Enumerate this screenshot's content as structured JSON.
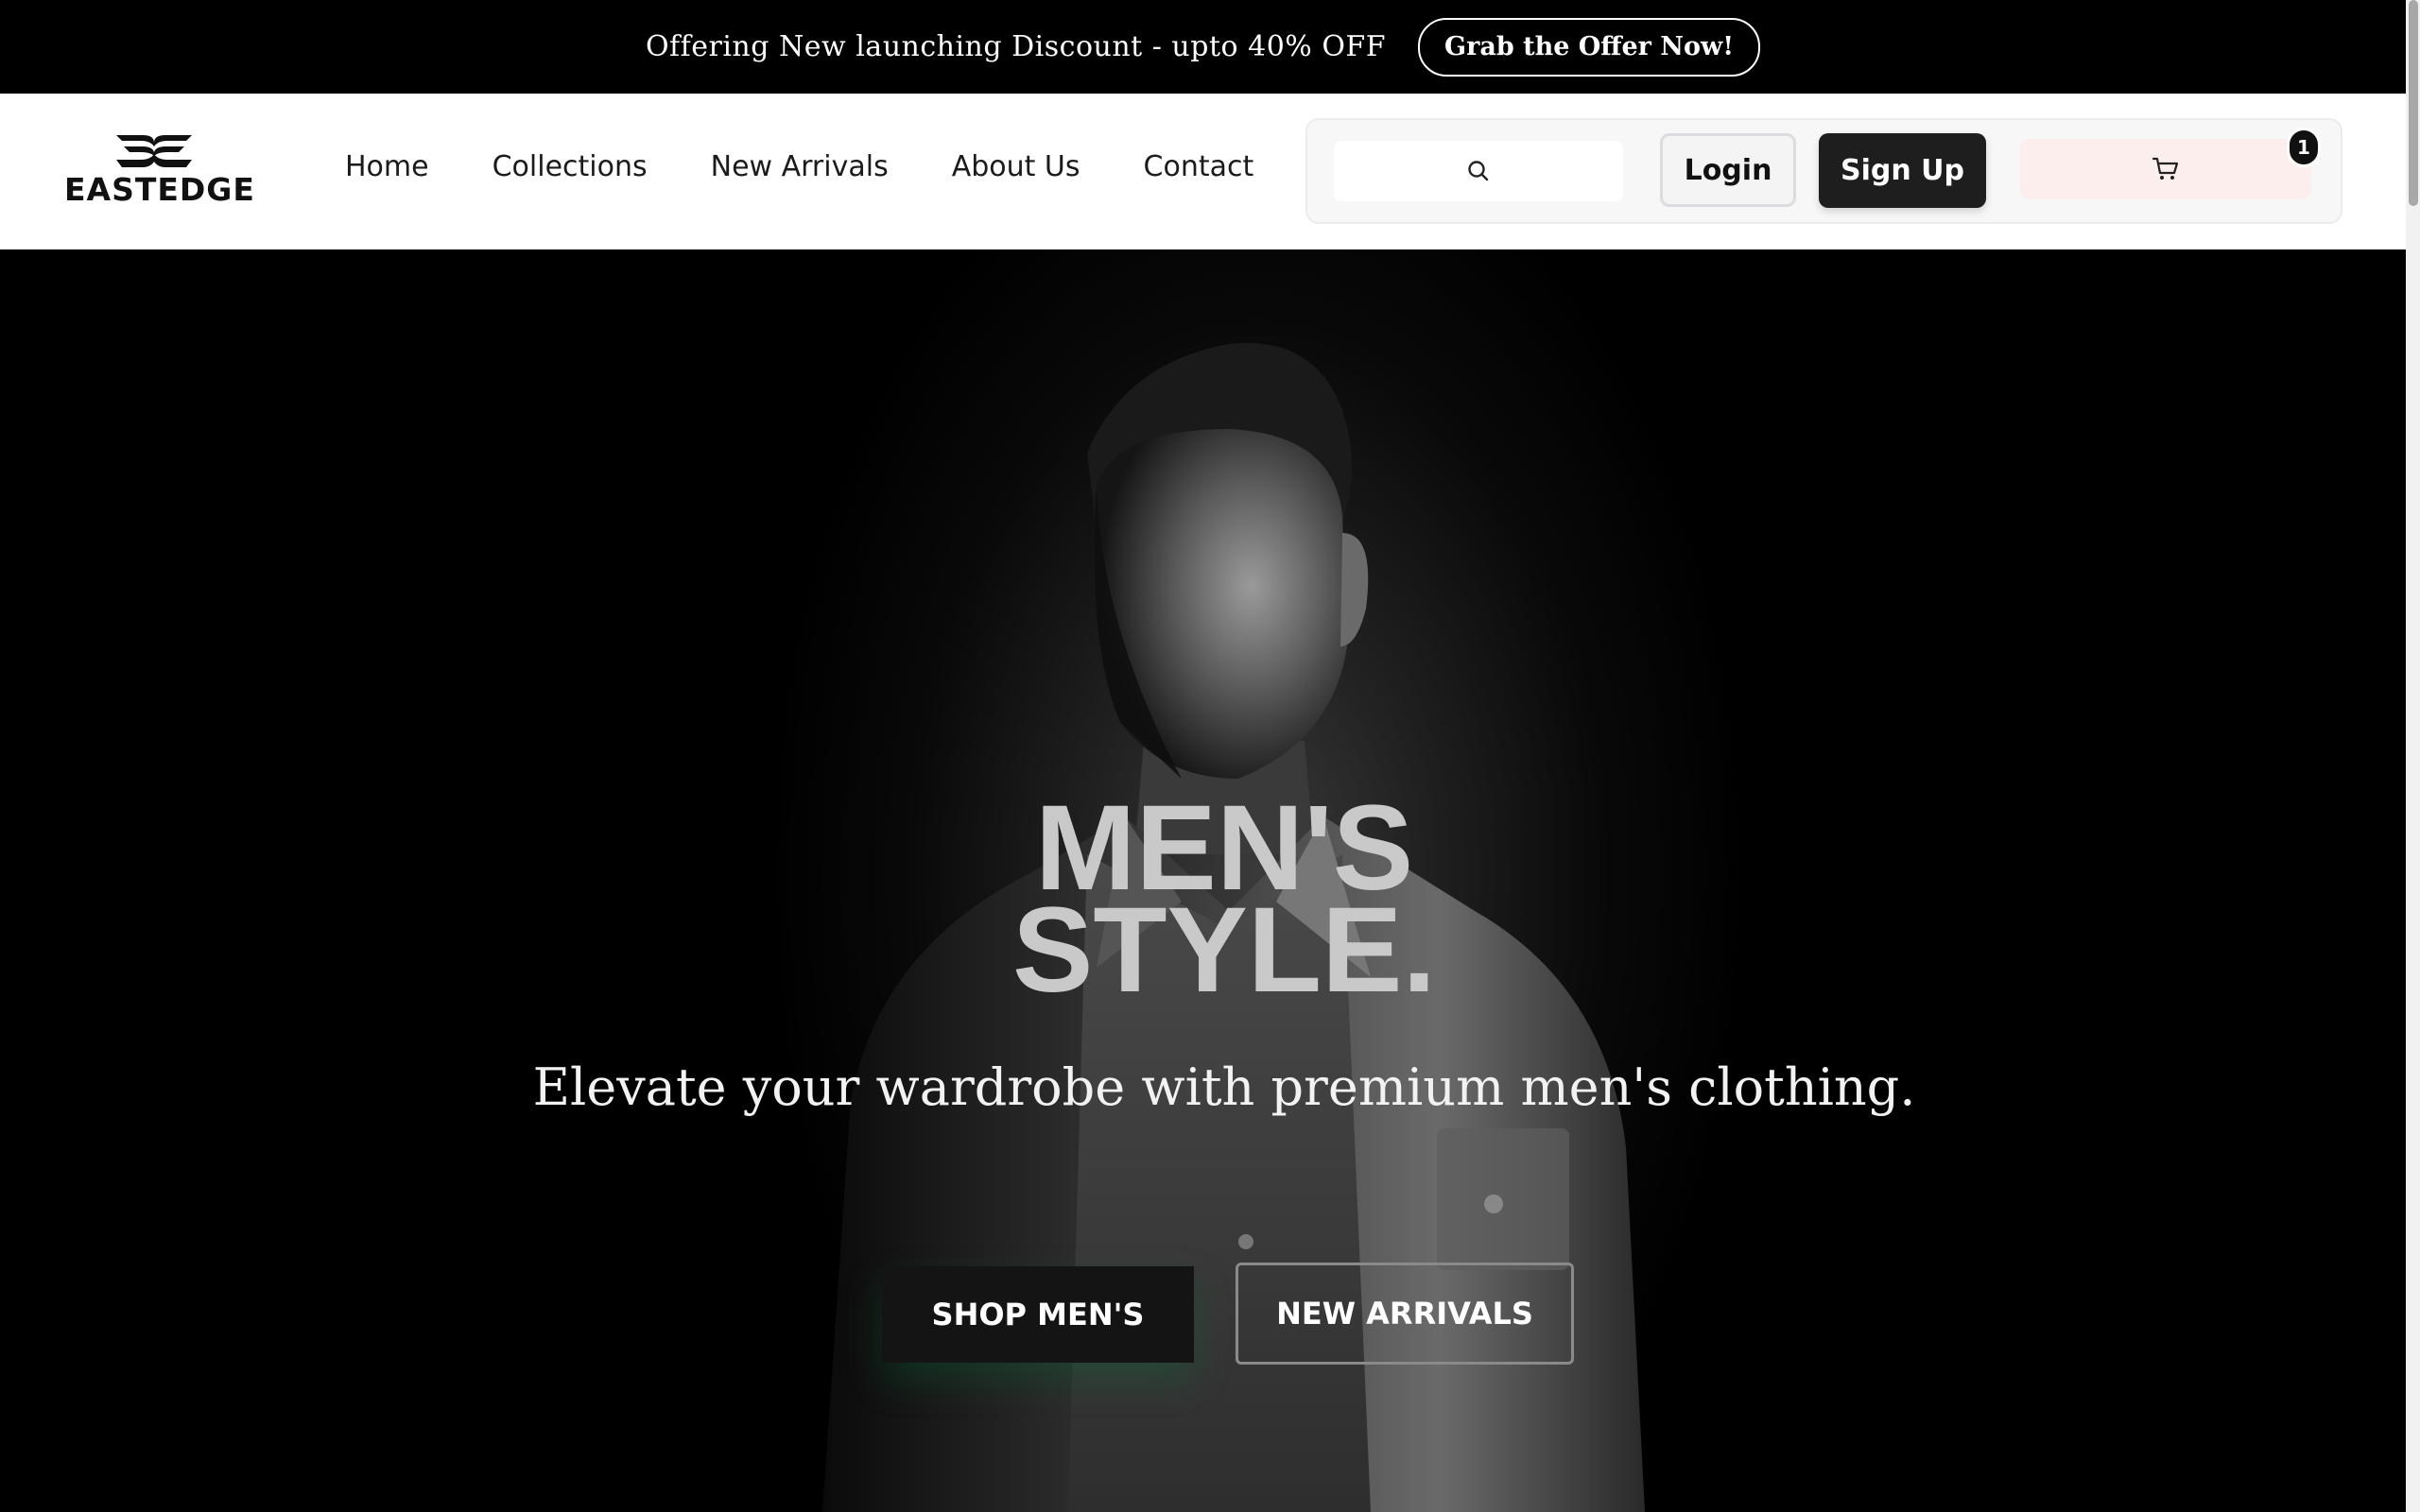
{
  "promo": {
    "text": "Offering New launching Discount - upto 40% OFF",
    "button": "Grab the Offer Now!"
  },
  "brand": {
    "name": "EASTEDGE"
  },
  "nav": {
    "items": [
      {
        "label": "Home"
      },
      {
        "label": "Collections"
      },
      {
        "label": "New Arrivals"
      },
      {
        "label": "About Us"
      },
      {
        "label": "Contact"
      }
    ]
  },
  "header": {
    "login_label": "Login",
    "signup_label": "Sign Up",
    "cart_count": "1",
    "search_icon": "search-icon",
    "cart_icon": "cart-icon"
  },
  "hero": {
    "title_line1": "MEN'S",
    "title_line2": "STYLE.",
    "subtitle": "Elevate your wardrobe with premium men's clothing.",
    "primary_button": "SHOP MEN'S",
    "secondary_button": "NEW ARRIVALS"
  },
  "colors": {
    "promo_bg": "#000000",
    "header_bg": "#ffffff",
    "signup_bg": "#1e1e1e",
    "cart_bg": "#fceeec",
    "hero_title": "#c9c9c9"
  }
}
